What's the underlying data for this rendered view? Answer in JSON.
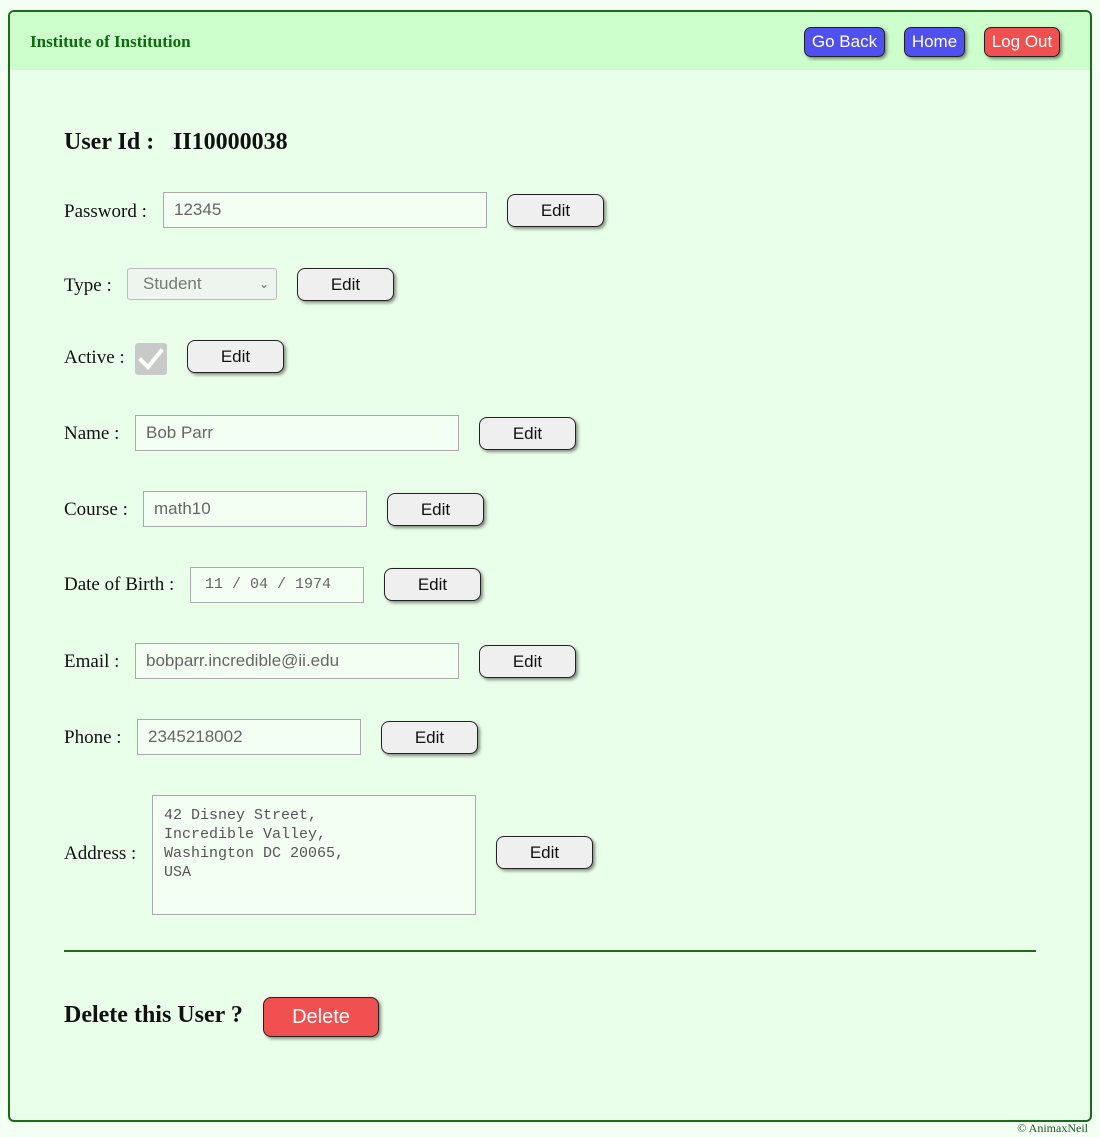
{
  "header": {
    "brand": "Institute of Institution",
    "go_back_label": "Go Back",
    "home_label": "Home",
    "logout_label": "Log Out"
  },
  "user": {
    "user_id_label": "User Id :",
    "user_id_value": "II10000038"
  },
  "fields": {
    "password": {
      "label": "Password :",
      "value": "12345"
    },
    "type": {
      "label": "Type :",
      "value": "Student"
    },
    "active": {
      "label": "Active :",
      "checked": true
    },
    "name": {
      "label": "Name :",
      "value": "Bob Parr"
    },
    "course": {
      "label": "Course :",
      "value": "math10"
    },
    "dob": {
      "label": "Date of Birth :",
      "value": "11 / 04 / 1974"
    },
    "email": {
      "label": "Email :",
      "value": "bobparr.incredible@ii.edu"
    },
    "phone": {
      "label": "Phone :",
      "value": "2345218002"
    },
    "address": {
      "label": "Address :",
      "lines": [
        "42 Disney Street,",
        "Incredible Valley,",
        "Washington DC 20065,",
        "USA"
      ]
    }
  },
  "edit_label": "Edit",
  "delete_section": {
    "prompt": "Delete this User ?",
    "delete_label": "Delete"
  },
  "footer": {
    "copyright": "© AnimaxNeil"
  },
  "colors": {
    "header_bg": "#ccffcc",
    "page_bg": "#eaffea",
    "brand_green": "#0f6b0f",
    "blue_button": "#5050f0",
    "red_button": "#f05050"
  }
}
